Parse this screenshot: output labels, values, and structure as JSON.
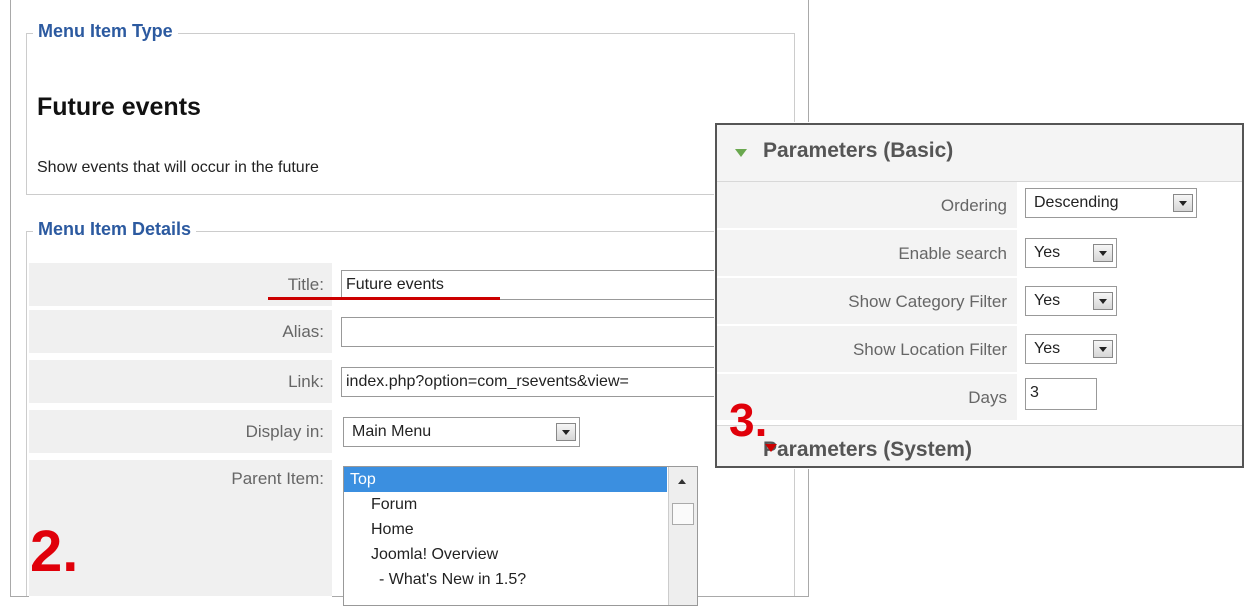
{
  "menu_item_type": {
    "legend": "Menu Item Type",
    "title": "Future events",
    "description": "Show events that will occur in the future"
  },
  "menu_item_details": {
    "legend": "Menu Item Details",
    "title_label": "Title:",
    "title_value": "Future events",
    "alias_label": "Alias:",
    "alias_value": "",
    "link_label": "Link:",
    "link_value": "index.php?option=com_rsevents&view=",
    "display_label": "Display in:",
    "display_value": "Main Menu",
    "parent_label": "Parent Item:",
    "parent_options": [
      "Top",
      "Forum",
      "Home",
      "Joomla! Overview",
      "- What's New in 1.5?"
    ],
    "parent_selected": "Top"
  },
  "parameters_basic": {
    "header": "Parameters (Basic)",
    "ordering_label": "Ordering",
    "ordering_value": "Descending",
    "enable_search_label": "Enable search",
    "enable_search_value": "Yes",
    "category_filter_label": "Show Category Filter",
    "category_filter_value": "Yes",
    "location_filter_label": "Show Location Filter",
    "location_filter_value": "Yes",
    "days_label": "Days",
    "days_value": "3"
  },
  "parameters_system": {
    "header": "Parameters (System)"
  },
  "annotations": {
    "step2": "2.",
    "step3": "3."
  },
  "colors": {
    "legend": "#2c5aa0",
    "selection": "#3b8fe0",
    "annotation": "#e0000a",
    "toggle": "#6aa84f"
  }
}
